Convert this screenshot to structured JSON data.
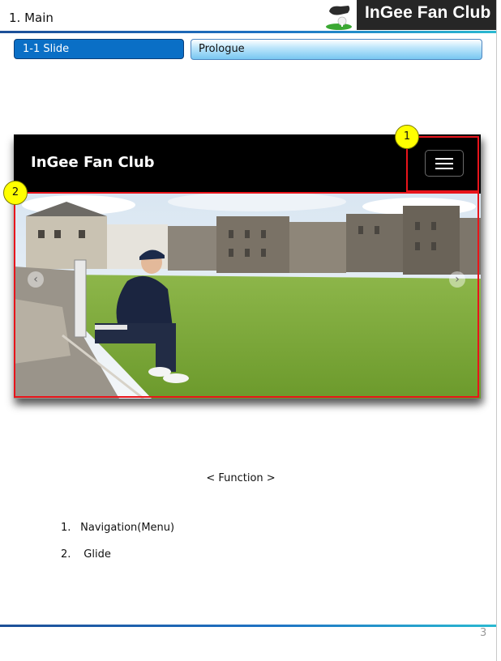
{
  "header": {
    "section_title": "1. Main",
    "brand": "InGee Fan Club"
  },
  "tabs": [
    {
      "label": "1-1  Slide",
      "active": true
    },
    {
      "label": "Prologue",
      "active": false
    }
  ],
  "mockup": {
    "site_title": "InGee Fan Club",
    "menu_icon": "hamburger-menu-icon",
    "slide_image": "photo of golfer sitting on steps by a golf course with stone buildings",
    "prev_icon": "chevron-left-icon",
    "next_icon": "chevron-right-icon"
  },
  "callouts": [
    "1",
    "2"
  ],
  "functions": {
    "title": "< Function >",
    "items": [
      {
        "num": "1.",
        "label": "Navigation(Menu)"
      },
      {
        "num": "2.",
        "label": " Glide"
      }
    ]
  },
  "page_number": "3",
  "colors": {
    "accent_blue": "#0a6fc6",
    "highlight_red": "#e8141b",
    "callout_yellow": "#ffff00"
  }
}
